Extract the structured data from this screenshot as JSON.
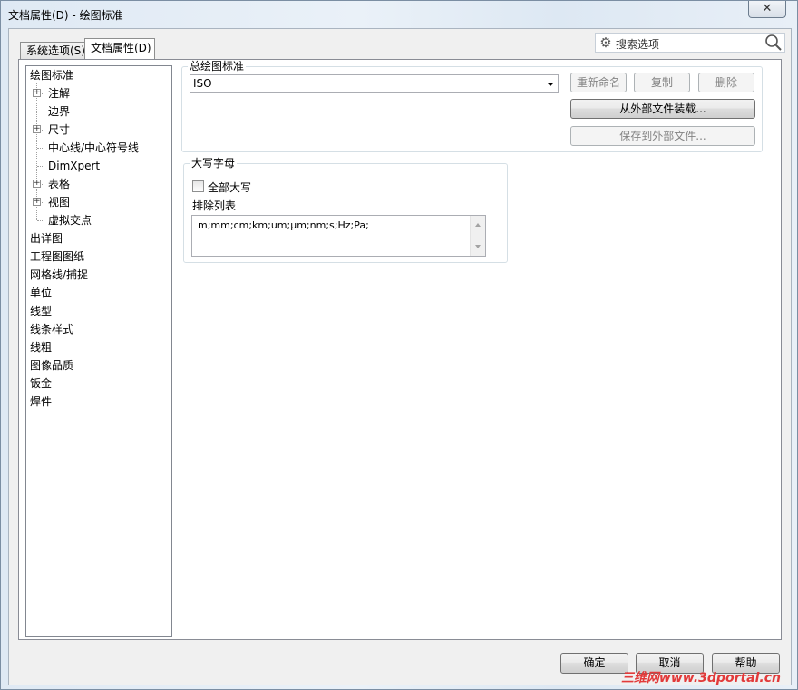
{
  "window": {
    "title": "文档属性(D) - 绘图标准",
    "close_symbol": "✕"
  },
  "tabs": [
    {
      "label": "系统选项(S)",
      "active": false
    },
    {
      "label": "文档属性(D)",
      "active": true
    }
  ],
  "search": {
    "label": "搜索选项",
    "gear_icon": "gear-icon",
    "magnifier_icon": "search-icon"
  },
  "tree": {
    "items": [
      {
        "label": "绘图标准",
        "level": 0,
        "selected": true
      },
      {
        "label": "注解",
        "level": 1,
        "expander": "+"
      },
      {
        "label": "边界",
        "level": 1
      },
      {
        "label": "尺寸",
        "level": 1,
        "expander": "+"
      },
      {
        "label": "中心线/中心符号线",
        "level": 1
      },
      {
        "label": "DimXpert",
        "level": 1
      },
      {
        "label": "表格",
        "level": 1,
        "expander": "+"
      },
      {
        "label": "视图",
        "level": 1,
        "expander": "+"
      },
      {
        "label": "虚拟交点",
        "level": 1
      },
      {
        "label": "出详图",
        "level": 0
      },
      {
        "label": "工程图图纸",
        "level": 0
      },
      {
        "label": "网格线/捕捉",
        "level": 0
      },
      {
        "label": "单位",
        "level": 0
      },
      {
        "label": "线型",
        "level": 0
      },
      {
        "label": "线条样式",
        "level": 0
      },
      {
        "label": "线粗",
        "level": 0
      },
      {
        "label": "图像品质",
        "level": 0
      },
      {
        "label": "钣金",
        "level": 0
      },
      {
        "label": "焊件",
        "level": 0
      }
    ]
  },
  "overall_standard": {
    "group_label": "总绘图标准",
    "selected_value": "ISO",
    "rename_label": "重新命名",
    "copy_label": "复制",
    "delete_label": "删除",
    "load_external_label": "从外部文件装载...",
    "save_external_label": "保存到外部文件..."
  },
  "uppercase": {
    "group_label": "大写字母",
    "all_uppercase_label": "全部大写",
    "all_uppercase_checked": false,
    "exclude_list_label": "排除列表",
    "exclude_list_value": "m;mm;cm;km;um;μm;nm;s;Hz;Pa;"
  },
  "footer": {
    "ok_label": "确定",
    "cancel_label": "取消",
    "help_label": "帮助"
  },
  "watermark": "三维网www.3dportal.cn"
}
